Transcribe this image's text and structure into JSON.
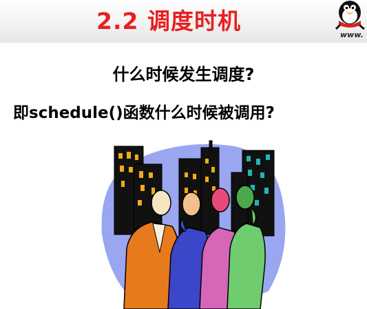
{
  "slide": {
    "title": "2.2 调度时机",
    "question_1": "什么时候发生调度?",
    "question_2": "即schedule()函数什么时候被调用?",
    "logo_text": "www.",
    "colors": {
      "title": "#e8201f",
      "text": "#000000",
      "background": "#ffffff"
    }
  },
  "icons": {
    "logo": "penguin-mascot-icon",
    "illustration": "business-people-city-clipart"
  }
}
